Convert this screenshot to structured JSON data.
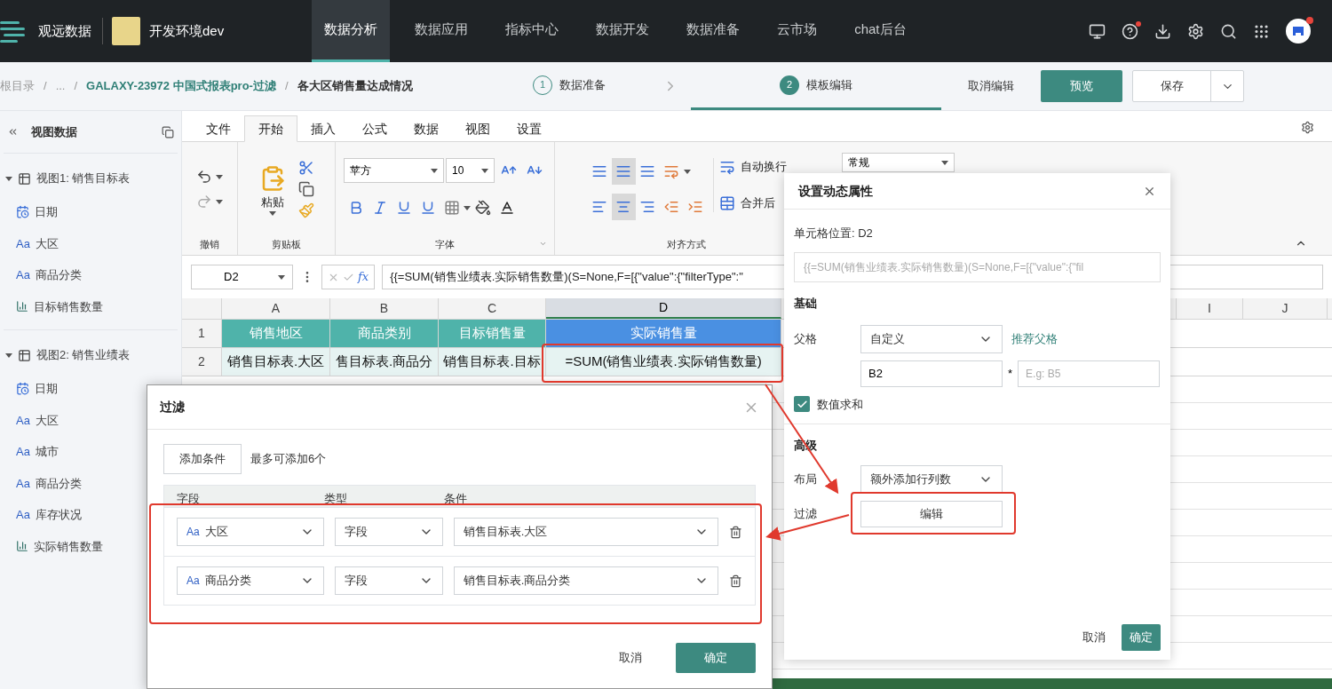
{
  "nav": {
    "brand": "观远数据",
    "env": "开发环境dev",
    "items": [
      {
        "label": "数据分析",
        "selected": true
      },
      {
        "label": "数据应用",
        "selected": false
      },
      {
        "label": "指标中心",
        "selected": false
      },
      {
        "label": "数据开发",
        "selected": false
      },
      {
        "label": "数据准备",
        "selected": false
      },
      {
        "label": "云市场",
        "selected": false
      },
      {
        "label": "chat后台",
        "selected": false
      }
    ],
    "help_badge": true,
    "avatar_badge": true
  },
  "breadcrumb": {
    "items": [
      {
        "label": "根目录",
        "kind": "root"
      },
      {
        "label": "...",
        "kind": "ellipsis"
      },
      {
        "label": "GALAXY-23972 中国式报表pro-过滤",
        "kind": "link"
      },
      {
        "label": "各大区销售量达成情况",
        "kind": "current"
      }
    ],
    "separators": [
      "/",
      "/",
      "/"
    ]
  },
  "steps": [
    {
      "number": "1",
      "label": "数据准备",
      "selected": false
    },
    {
      "number": "2",
      "label": "模板编辑",
      "selected": true
    }
  ],
  "actions": {
    "cancel": "取消编辑",
    "preview": "预览",
    "save": "保存"
  },
  "sidebar": {
    "title": "视图数据",
    "groups": [
      {
        "title": "视图1: 销售目标表",
        "expanded": true,
        "fields": [
          {
            "kind": "date",
            "label": "日期"
          },
          {
            "kind": "text",
            "icon": "Aa",
            "label": "大区"
          },
          {
            "kind": "text",
            "icon": "Aa",
            "label": "商品分类"
          },
          {
            "kind": "measure",
            "label": "目标销售数量"
          }
        ]
      },
      {
        "title": "视图2: 销售业绩表",
        "expanded": true,
        "fields": [
          {
            "kind": "date",
            "label": "日期"
          },
          {
            "kind": "text",
            "icon": "Aa",
            "label": "大区"
          },
          {
            "kind": "text",
            "icon": "Aa",
            "label": "城市"
          },
          {
            "kind": "text",
            "icon": "Aa",
            "label": "商品分类"
          },
          {
            "kind": "text",
            "icon": "Aa",
            "label": "库存状况"
          },
          {
            "kind": "measure",
            "label": "实际销售数量"
          }
        ]
      }
    ]
  },
  "ribbon": {
    "tabs": [
      {
        "label": "文件",
        "selected": false
      },
      {
        "label": "开始",
        "selected": true
      },
      {
        "label": "插入",
        "selected": false
      },
      {
        "label": "公式",
        "selected": false
      },
      {
        "label": "数据",
        "selected": false
      },
      {
        "label": "视图",
        "selected": false
      },
      {
        "label": "设置",
        "selected": false
      }
    ],
    "groups": [
      "撤销",
      "剪贴板",
      "字体",
      "对齐方式"
    ],
    "paste": "粘贴",
    "font": "苹方",
    "size": "10",
    "wrap": "自动换行",
    "merge": "合并后",
    "number_format": "常规"
  },
  "formula": {
    "cell": "D2",
    "fx": "fx",
    "text": "{{=SUM(销售业绩表.实际销售数量)(S=None,F=[{\"value\":{\"filterType\":\""
  },
  "grid": {
    "columns": [
      {
        "letter": "A",
        "selected": false
      },
      {
        "letter": "B",
        "selected": false
      },
      {
        "letter": "C",
        "selected": false
      },
      {
        "letter": "D",
        "selected": true
      },
      {
        "letter": "I",
        "selected": false
      },
      {
        "letter": "J",
        "selected": false
      }
    ],
    "rows": [
      {
        "number": "1",
        "kind": "header",
        "cells": [
          "销售地区",
          "商品类别",
          "目标销售量",
          "实际销售量"
        ]
      },
      {
        "number": "2",
        "kind": "binding",
        "cells": [
          "销售目标表.大区",
          "售目标表.商品分",
          "销售目标表.目标",
          "=SUM(销售业绩表.实际销售数量)"
        ]
      }
    ]
  },
  "panel": {
    "title": "设置动态属性",
    "cell_position": "单元格位置: D2",
    "formula_preview": "{{=SUM(销售业绩表.实际销售数量)(S=None,F=[{\"value\":{\"fil",
    "basic_title": "基础",
    "parent_label": "父格",
    "parent_mode": "自定义",
    "recommend": "推荐父格",
    "parent_cell": "B2",
    "required_mark": "*",
    "child_placeholder": "E.g: B5",
    "sum_label": "数值求和",
    "sum_checked": true,
    "advanced_title": "高级",
    "layout_label": "布局",
    "layout_value": "额外添加行列数",
    "filter_label": "过滤",
    "filter_button": "编辑",
    "cancel": "取消",
    "ok": "确定"
  },
  "filter": {
    "title": "过滤",
    "add": "添加条件",
    "hint": "最多可添加6个",
    "columns": [
      "字段",
      "类型",
      "条件"
    ],
    "rows": [
      {
        "field_icon": "Aa",
        "field": "大区",
        "type": "字段",
        "condition": "销售目标表.大区"
      },
      {
        "field_icon": "Aa",
        "field": "商品分类",
        "type": "字段",
        "condition": "销售目标表.商品分类"
      }
    ],
    "cancel": "取消",
    "ok": "确定"
  }
}
